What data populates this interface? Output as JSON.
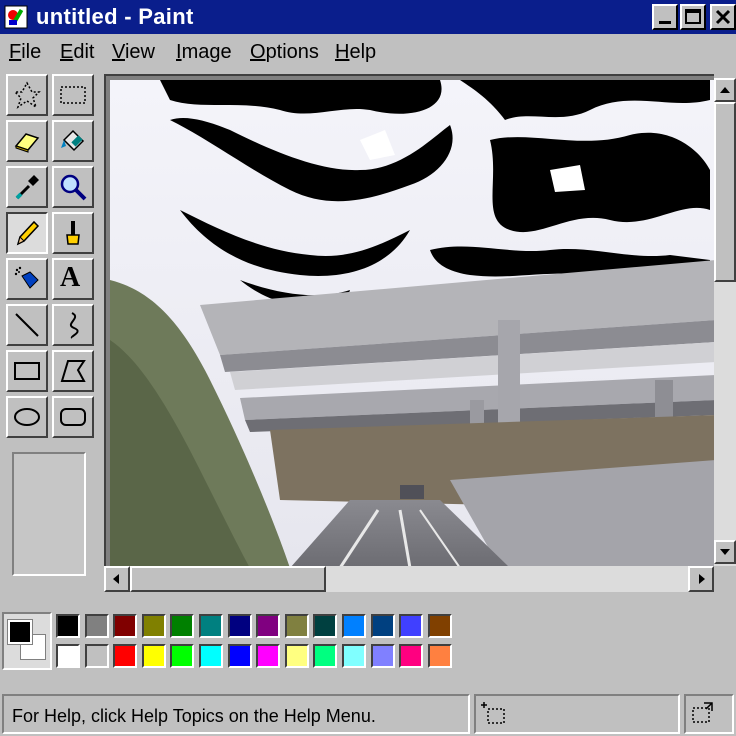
{
  "window": {
    "title": "untitled - Paint",
    "app_icon": "paint-app-icon",
    "controls": [
      "minimize-icon",
      "maximize-icon",
      "close-icon"
    ]
  },
  "menu": [
    {
      "label": "File",
      "accel": "F"
    },
    {
      "label": "Edit",
      "accel": "E"
    },
    {
      "label": "View",
      "accel": "V"
    },
    {
      "label": "Image",
      "accel": "I"
    },
    {
      "label": "Options",
      "accel": "O"
    },
    {
      "label": "Help",
      "accel": "H"
    }
  ],
  "tools": [
    {
      "name": "free-form-select-icon",
      "active": false
    },
    {
      "name": "rectangle-select-icon",
      "active": false
    },
    {
      "name": "eraser-icon",
      "active": false
    },
    {
      "name": "fill-bucket-icon",
      "active": false
    },
    {
      "name": "color-picker-icon",
      "active": false
    },
    {
      "name": "magnifier-icon",
      "active": false
    },
    {
      "name": "pencil-icon",
      "active": true
    },
    {
      "name": "brush-icon",
      "active": false
    },
    {
      "name": "airbrush-icon",
      "active": false
    },
    {
      "name": "text-icon",
      "active": false,
      "glyph": "A"
    },
    {
      "name": "line-icon",
      "active": false
    },
    {
      "name": "curve-icon",
      "active": false
    },
    {
      "name": "rectangle-icon",
      "active": false
    },
    {
      "name": "polygon-icon",
      "active": false
    },
    {
      "name": "ellipse-icon",
      "active": false
    },
    {
      "name": "rounded-rectangle-icon",
      "active": false
    }
  ],
  "canvas": {
    "image": "photo-overpass-road-with-bw-noise"
  },
  "colors": {
    "foreground": "#000000",
    "background": "#ffffff",
    "palette_top": [
      "#000000",
      "#808080",
      "#800000",
      "#808000",
      "#008000",
      "#008080",
      "#000080",
      "#800080",
      "#808040",
      "#004040",
      "#0080ff",
      "#004080",
      "#4040ff",
      "#804000"
    ],
    "palette_bottom": [
      "#ffffff",
      "#c0c0c0",
      "#ff0000",
      "#ffff00",
      "#00ff00",
      "#00ffff",
      "#0000ff",
      "#ff00ff",
      "#ffff80",
      "#00ff80",
      "#80ffff",
      "#8080ff",
      "#ff0080",
      "#ff8040"
    ]
  },
  "status": {
    "help_text": "For Help, click Help Topics on the Help Menu.",
    "position_icon": "cursor-position-icon",
    "size_icon": "selection-size-icon"
  }
}
